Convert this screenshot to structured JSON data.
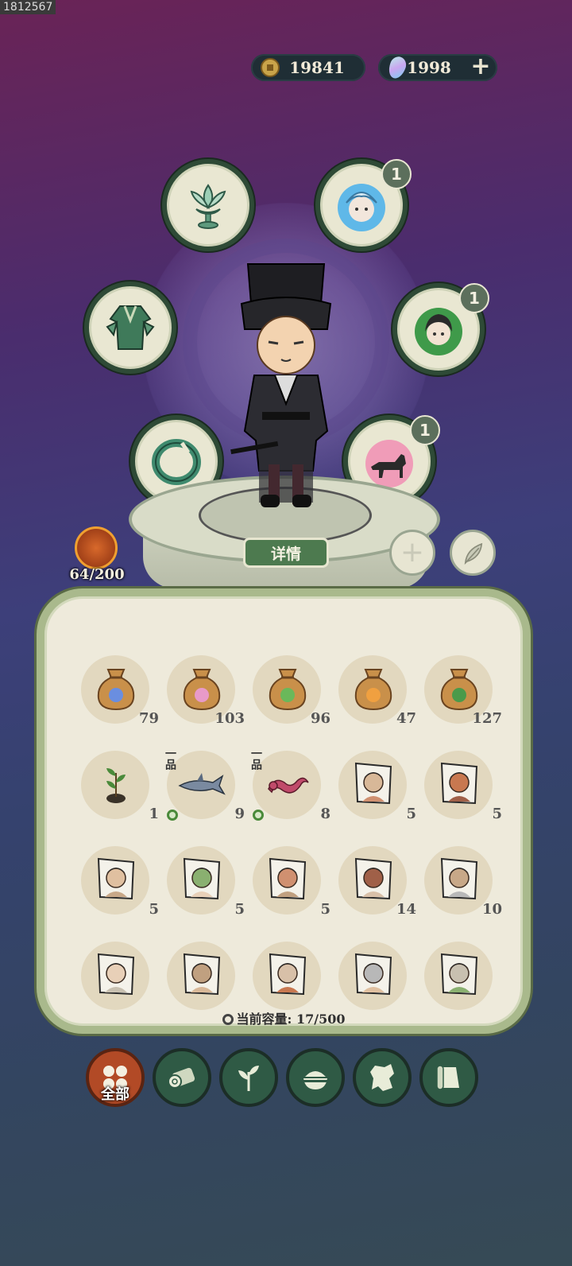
{
  "watermark": "1812567",
  "currency": {
    "coins": "19841",
    "gems": "1998"
  },
  "slots": [
    {
      "id": "lotus",
      "badge": ""
    },
    {
      "id": "spirit",
      "badge": "1"
    },
    {
      "id": "armor",
      "badge": ""
    },
    {
      "id": "companion",
      "badge": "1"
    },
    {
      "id": "bracelet",
      "badge": ""
    },
    {
      "id": "pet",
      "badge": "1"
    }
  ],
  "detail_button": "详情",
  "level": "64/200",
  "items": [
    {
      "name": "seed-bag-blue",
      "count": "79"
    },
    {
      "name": "seed-bag-pink",
      "count": "103"
    },
    {
      "name": "seed-bag-green",
      "count": "96"
    },
    {
      "name": "seed-bag-orange",
      "count": "47"
    },
    {
      "name": "seed-bag-leaf",
      "count": "127"
    },
    {
      "name": "sapling",
      "count": "1"
    },
    {
      "name": "shark",
      "count": "9",
      "grade": "一品"
    },
    {
      "name": "dragon",
      "count": "8",
      "grade": "一品"
    },
    {
      "name": "character-card-1",
      "count": "5"
    },
    {
      "name": "character-card-2",
      "count": "5"
    },
    {
      "name": "character-card-3",
      "count": "5"
    },
    {
      "name": "character-card-4",
      "count": "5"
    },
    {
      "name": "character-card-5",
      "count": "5"
    },
    {
      "name": "character-card-6",
      "count": "14"
    },
    {
      "name": "character-card-7",
      "count": "10"
    },
    {
      "name": "character-card-8",
      "count": ""
    },
    {
      "name": "character-card-9",
      "count": ""
    },
    {
      "name": "character-card-10",
      "count": ""
    },
    {
      "name": "character-card-11",
      "count": ""
    },
    {
      "name": "character-card-12",
      "count": ""
    }
  ],
  "capacity": "当前容量: 17/500",
  "tabs": [
    {
      "id": "all",
      "label": "全部"
    },
    {
      "id": "wood"
    },
    {
      "id": "plant"
    },
    {
      "id": "food"
    },
    {
      "id": "map-piece"
    },
    {
      "id": "scroll"
    }
  ]
}
